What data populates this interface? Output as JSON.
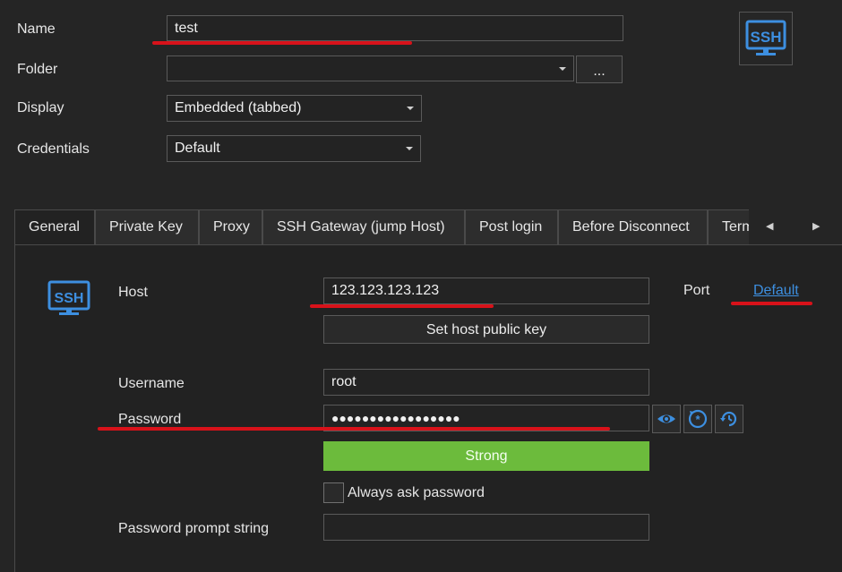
{
  "form": {
    "name_label": "Name",
    "name_value": "test",
    "folder_label": "Folder",
    "folder_value": "",
    "browse_label": "...",
    "display_label": "Display",
    "display_value": "Embedded (tabbed)",
    "credentials_label": "Credentials",
    "credentials_value": "Default",
    "ssh_logo_text": "SSH"
  },
  "tabs": [
    {
      "label": "General",
      "active": true
    },
    {
      "label": "Private Key"
    },
    {
      "label": "Proxy"
    },
    {
      "label": "SSH Gateway (jump Host)"
    },
    {
      "label": "Post login"
    },
    {
      "label": "Before Disconnect"
    },
    {
      "label": "Terminal"
    }
  ],
  "general": {
    "ssh_logo_text": "SSH",
    "host_label": "Host",
    "host_value": "123.123.123.123",
    "port_label": "Port",
    "port_value": "Default",
    "set_host_key_label": "Set host public key",
    "username_label": "Username",
    "username_value": "root",
    "password_label": "Password",
    "password_value": "●●●●●●●●●●●●●●●●●",
    "strength_label": "Strong",
    "strength_color": "#6cbb3c",
    "always_ask_label": "Always ask password",
    "always_ask_checked": false,
    "prompt_label": "Password prompt string",
    "prompt_value": ""
  },
  "colors": {
    "accent_blue": "#3d8fe0",
    "annotation_red": "#d8121a"
  }
}
